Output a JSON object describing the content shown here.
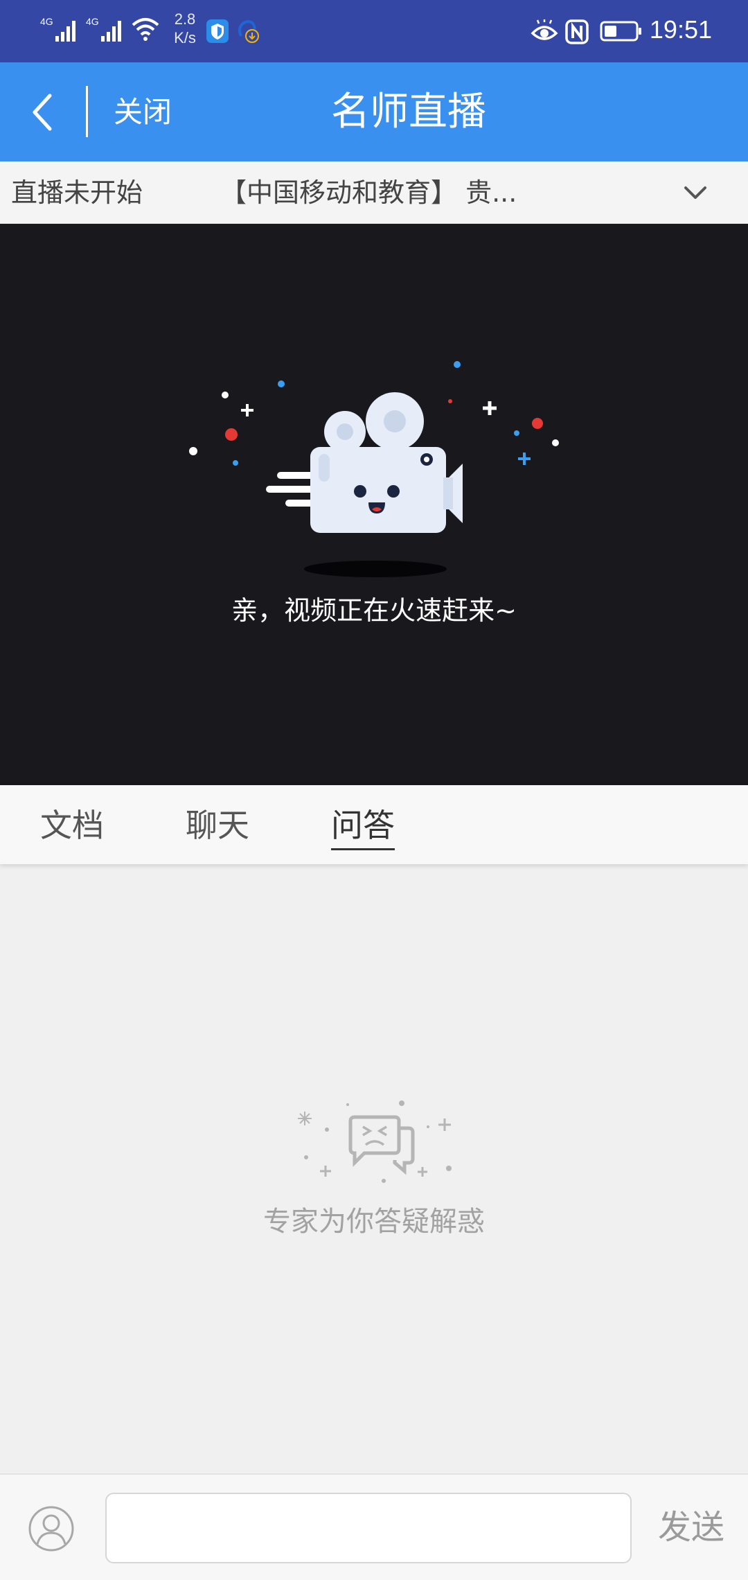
{
  "status_bar": {
    "network_1": "4G",
    "network_2": "4G",
    "speed_value": "2.8",
    "speed_unit": "K/s",
    "time": "19:51",
    "icons": [
      "signal-icon",
      "signal-icon",
      "wifi-icon",
      "shield-app-icon",
      "download-app-icon",
      "eye-comfort-icon",
      "nfc-icon",
      "battery-icon"
    ]
  },
  "nav": {
    "close_label": "关闭",
    "title": "名师直播"
  },
  "live_info": {
    "status": "直播未开始",
    "course_title": "【中国移动和教育】 贵..."
  },
  "video": {
    "message": "亲，视频正在火速赶来~"
  },
  "tabs": [
    {
      "label": "文档",
      "active": false
    },
    {
      "label": "聊天",
      "active": false
    },
    {
      "label": "问答",
      "active": true
    }
  ],
  "empty_state": {
    "text": "专家为你答疑解惑"
  },
  "bottom_bar": {
    "input_value": "",
    "send_label": "发送"
  },
  "colors": {
    "status_bar": "#3447a4",
    "nav_bar": "#3a90ef",
    "video_bg": "#18181d",
    "accent_red": "#e53935",
    "accent_blue": "#3a9ff0"
  }
}
